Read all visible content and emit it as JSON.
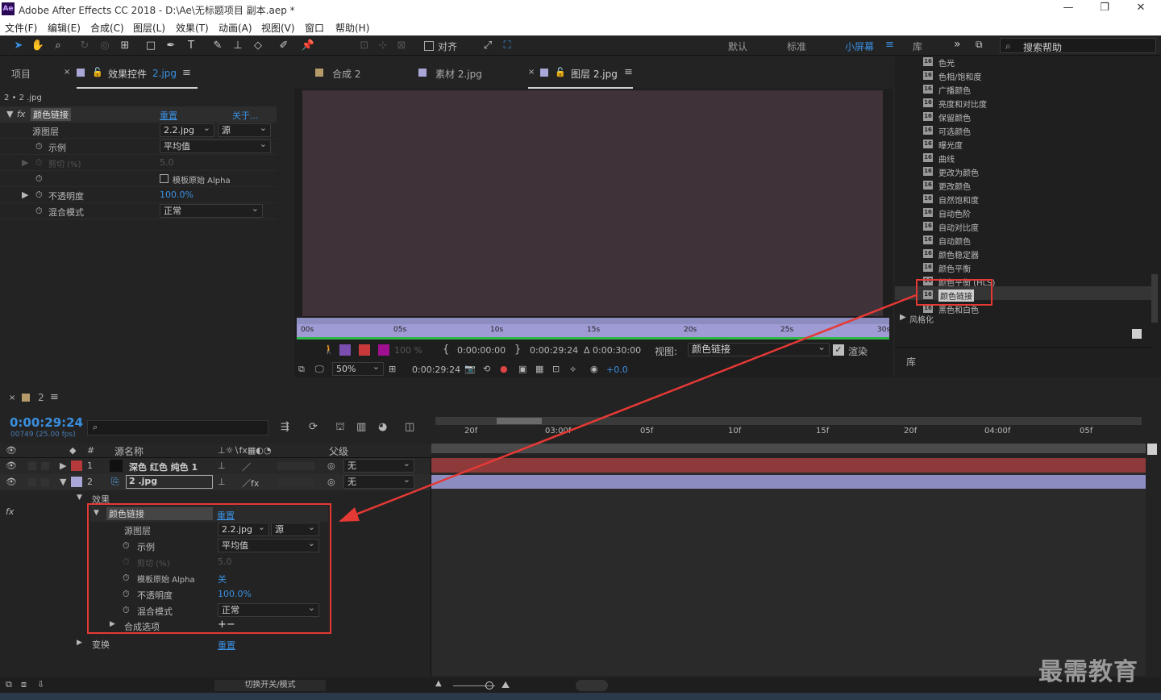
{
  "app": {
    "title": "Adobe After Effects CC 2018 - D:\\Ae\\无标题项目 副本.aep *",
    "logo": "Ae"
  },
  "menu": [
    "文件(F)",
    "编辑(E)",
    "合成(C)",
    "图层(L)",
    "效果(T)",
    "动画(A)",
    "视图(V)",
    "窗口",
    "帮助(H)"
  ],
  "toolbar": {
    "snap_label": "对齐",
    "workspaces": [
      "默认",
      "标准",
      "小屏幕",
      "库"
    ],
    "active_workspace": "小屏幕",
    "search_placeholder": "搜索帮助"
  },
  "left_panel": {
    "tab_project": "项目",
    "tab_effects": "效果控件",
    "tab_effects_file": "2.jpg",
    "breadcrumb": "2 • 2 .jpg",
    "effect_name": "颜色链接",
    "reset": "重置",
    "about": "关于...",
    "props": [
      {
        "label": "源图层",
        "value": "2.2.jpg",
        "value2": "源"
      },
      {
        "label": "示例",
        "value": "平均值"
      },
      {
        "label": "剪切 (%)",
        "value": "5.0"
      },
      {
        "label": "模板原始 Alpha"
      },
      {
        "label": "不透明度",
        "value": "100.0%"
      },
      {
        "label": "混合模式",
        "value": "正常"
      }
    ]
  },
  "viewer": {
    "tabs": [
      "合成 2",
      "素材 2.jpg",
      "图层 2.jpg"
    ],
    "ruler": [
      "00s",
      "05s",
      "10s",
      "15s",
      "20s",
      "25s",
      "30s"
    ],
    "opacity": "100 %",
    "in_time": "0:00:00:00",
    "out_time": "0:00:29:24",
    "duration": "Δ 0:00:30:00",
    "view_label": "视图:",
    "view_value": "颜色链接",
    "render_label": "渲染",
    "zoom": "50%",
    "current_time": "0:00:29:24",
    "exposure": "+0.0"
  },
  "effects_list": {
    "items": [
      "色光",
      "色相/饱和度",
      "广播颜色",
      "亮度和对比度",
      "保留颜色",
      "可选颜色",
      "曝光度",
      "曲线",
      "更改为颜色",
      "更改颜色",
      "自然饱和度",
      "自动色阶",
      "自动对比度",
      "自动颜色",
      "颜色稳定器",
      "颜色平衡",
      "颜色平衡 (HLS)",
      "颜色链接",
      "黑色和白色"
    ],
    "selected": "颜色链接",
    "group": "风格化",
    "library_tab": "库"
  },
  "timeline": {
    "comp_tab": "2",
    "timecode": "0:00:29:24",
    "fps": "00749 (25.00 fps)",
    "search_placeholder": "",
    "columns": {
      "num": "#",
      "source": "源名称",
      "parent": "父级"
    },
    "layers": [
      {
        "num": "1",
        "name": "深色 红色 纯色 1",
        "parent": "无",
        "color": "#b73a3a"
      },
      {
        "num": "2",
        "name": "2 .jpg",
        "parent": "无",
        "color": "#a9a6d8"
      }
    ],
    "effects_group": "效果",
    "effect_name": "颜色链接",
    "reset": "重置",
    "props": [
      {
        "label": "源图层",
        "value": "2.2.jpg",
        "value2": "源"
      },
      {
        "label": "示例",
        "value": "平均值"
      },
      {
        "label": "剪切 (%)",
        "value": "5.0"
      },
      {
        "label": "模板原始 Alpha",
        "value": "关"
      },
      {
        "label": "不透明度",
        "value": "100.0%"
      },
      {
        "label": "混合模式",
        "value": "正常"
      },
      {
        "label": "合成选项",
        "value": "+−"
      }
    ],
    "transform": "变换",
    "transform_reset": "重置",
    "ruler": [
      "20f",
      "03:00f",
      "05f",
      "10f",
      "15f",
      "20f",
      "04:00f",
      "05f"
    ],
    "toggle_label": "切换开关/模式"
  },
  "watermark": "最需教育",
  "colors": {
    "accent": "#3a8fe0",
    "highlight_box": "#e53935",
    "solid_layer": "#b73a3a",
    "jpg_layer": "#a9a6d8",
    "viewer_bg": "#3f3239"
  }
}
